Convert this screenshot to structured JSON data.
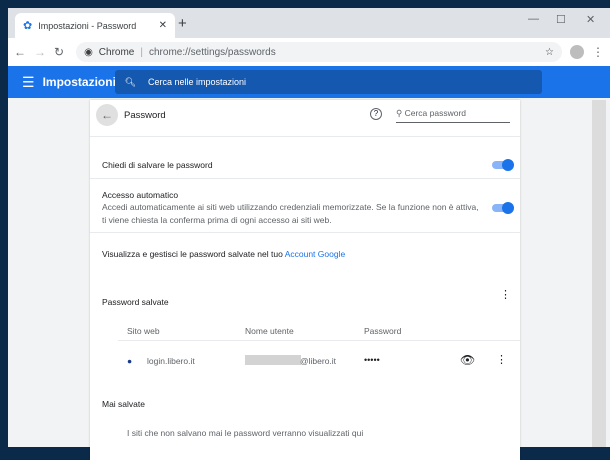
{
  "tab": {
    "title": "Impostazioni - Password"
  },
  "omnibox": {
    "site": "Chrome",
    "url": "chrome://settings/passwords"
  },
  "header": {
    "title": "Impostazioni",
    "search_placeholder": "Cerca nelle impostazioni"
  },
  "page": {
    "title": "Password",
    "search_placeholder": "Cerca password",
    "offer_save": "Chiedi di salvare le password",
    "auto_signin_title": "Accesso automatico",
    "auto_signin_desc1": "Accedi automaticamente ai siti web utilizzando credenziali memorizzate. Se la funzione non è attiva,",
    "auto_signin_desc2": "ti viene chiesta la conferma prima di ogni accesso ai siti web.",
    "manage_text": "Visualizza e gestisci le password salvate nel tuo ",
    "manage_link": "Account Google",
    "saved_title": "Password salvate",
    "columns": [
      "Sito web",
      "Nome utente",
      "Password"
    ],
    "rows": [
      {
        "site": "login.libero.it",
        "user": "@libero.it",
        "password": "•••••"
      }
    ],
    "never_title": "Mai salvate",
    "never_empty": "I siti che non salvano mai le password verranno visualizzati qui"
  }
}
